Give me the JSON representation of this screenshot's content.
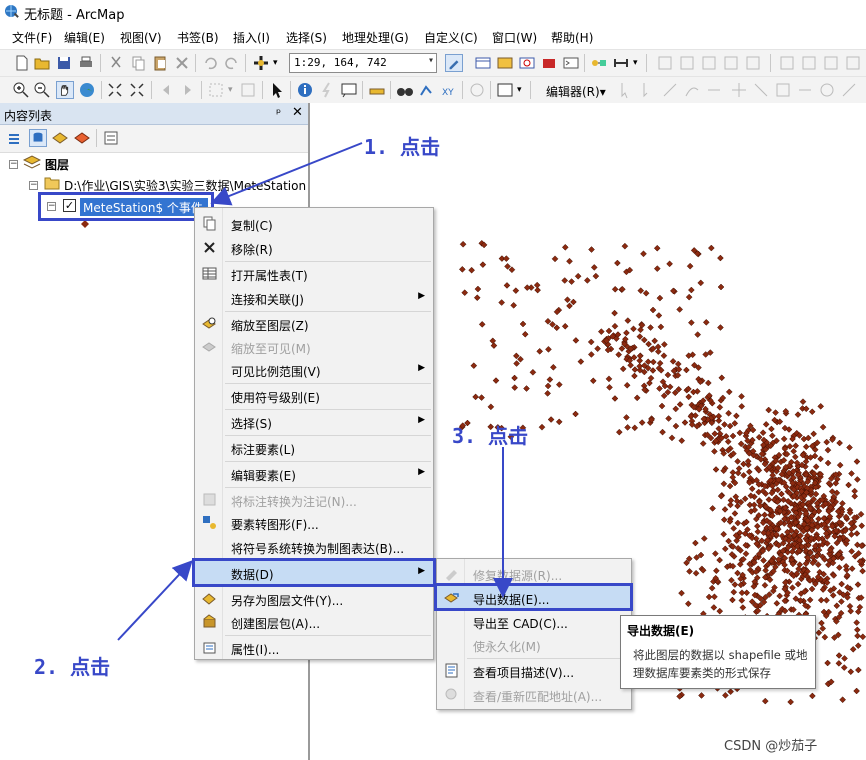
{
  "window": {
    "title": "无标题 - ArcMap"
  },
  "menubar": {
    "items": [
      "文件(F)",
      "编辑(E)",
      "视图(V)",
      "书签(B)",
      "插入(I)",
      "选择(S)",
      "地理处理(G)",
      "自定义(C)",
      "窗口(W)",
      "帮助(H)"
    ]
  },
  "toolbar": {
    "scale": "1:29, 164, 742",
    "editor_label": "编辑器(R)▾"
  },
  "toc": {
    "title": "内容列表",
    "pin": "ᵖ",
    "close": "✕",
    "root_label": "图层",
    "folder_label": "D:\\作业\\GIS\\实验3\\实验三数据\\MeteStation",
    "layer_label": "MeteStation$ 个事件",
    "layer_checked": "✓"
  },
  "context_menu": {
    "items": [
      {
        "label": "复制(C)",
        "icon": "copy-icon",
        "disabled": false,
        "submenu": false
      },
      {
        "label": "移除(R)",
        "icon": "remove-icon",
        "disabled": false,
        "submenu": false
      },
      {
        "label": "打开属性表(T)",
        "icon": "table-icon",
        "disabled": false,
        "submenu": false
      },
      {
        "label": "连接和关联(J)",
        "icon": "",
        "disabled": false,
        "submenu": true
      },
      {
        "label": "缩放至图层(Z)",
        "icon": "zoom-layer-icon",
        "disabled": false,
        "submenu": false
      },
      {
        "label": "缩放至可见(M)",
        "icon": "zoom-visible-icon",
        "disabled": true,
        "submenu": false
      },
      {
        "label": "可见比例范围(V)",
        "icon": "",
        "disabled": false,
        "submenu": true
      },
      {
        "label": "使用符号级别(E)",
        "icon": "",
        "disabled": false,
        "submenu": false
      },
      {
        "label": "选择(S)",
        "icon": "",
        "disabled": false,
        "submenu": true
      },
      {
        "label": "标注要素(L)",
        "icon": "",
        "disabled": false,
        "submenu": false
      },
      {
        "label": "编辑要素(E)",
        "icon": "",
        "disabled": false,
        "submenu": true
      },
      {
        "label": "将标注转换为注记(N)...",
        "icon": "annotation-icon",
        "disabled": true,
        "submenu": false
      },
      {
        "label": "要素转图形(F)...",
        "icon": "features-graphics-icon",
        "disabled": false,
        "submenu": false
      },
      {
        "label": "将符号系统转换为制图表达(B)...",
        "icon": "",
        "disabled": false,
        "submenu": false
      },
      {
        "label": "数据(D)",
        "icon": "",
        "disabled": false,
        "submenu": true
      },
      {
        "label": "另存为图层文件(Y)...",
        "icon": "layer-file-icon",
        "disabled": false,
        "submenu": false
      },
      {
        "label": "创建图层包(A)...",
        "icon": "layer-package-icon",
        "disabled": false,
        "submenu": false
      },
      {
        "label": "属性(I)...",
        "icon": "properties-icon",
        "disabled": false,
        "submenu": false
      }
    ]
  },
  "submenu": {
    "items": [
      {
        "label": "修复数据源(R)...",
        "disabled": true
      },
      {
        "label": "导出数据(E)...",
        "disabled": false
      },
      {
        "label": "导出至 CAD(C)...",
        "disabled": false
      },
      {
        "label": "使永久化(M)",
        "disabled": true
      },
      {
        "label": "查看项目描述(V)...",
        "disabled": false
      },
      {
        "label": "查看/重新匹配地址(A)...",
        "disabled": true
      }
    ]
  },
  "tooltip": {
    "title": "导出数据(E)",
    "desc": "将此图层的数据以 shapefile 或地理数据库要素类的形式保存"
  },
  "annotations": {
    "step1": "1. 点击",
    "step2": "2. 点击",
    "step3": "3. 点击"
  },
  "watermark": "CSDN @炒茄子",
  "colors": {
    "accent": "#3848c8",
    "selection": "#3374d1",
    "point_fill": "#8b2a10"
  }
}
